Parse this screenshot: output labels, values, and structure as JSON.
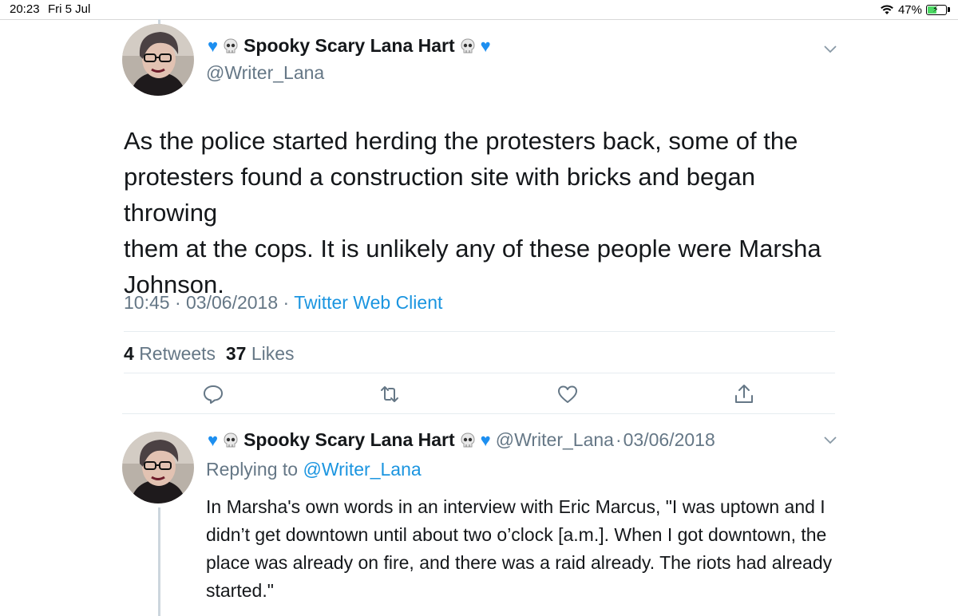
{
  "status_bar": {
    "time": "20:23",
    "date": "Fri 5 Jul",
    "battery": "47%",
    "battery_level": 0.47
  },
  "tweet": {
    "author": {
      "display_name": "Spooky Scary Lana Hart",
      "handle": "@Writer_Lana",
      "decorations": [
        "blue-heart-icon",
        "skull-icon"
      ]
    },
    "text_lines": [
      "As the police started herding the protesters back, some of the",
      "protesters found a construction site with bricks and began throwing",
      "them at the cops. It is unlikely any of these people were Marsha",
      "Johnson."
    ],
    "time": "10:45",
    "date": "03/06/2018",
    "sep": "·",
    "client": "Twitter Web Client",
    "retweets_count": "4",
    "retweets_label": "Retweets",
    "likes_count": "37",
    "likes_label": "Likes",
    "actions": [
      "reply-icon",
      "retweet-icon",
      "like-icon",
      "share-icon"
    ]
  },
  "reply": {
    "author": {
      "display_name": "Spooky Scary Lana Hart",
      "handle": "@Writer_Lana"
    },
    "date": "03/06/2018",
    "sep": "·",
    "replying_label": "Replying to",
    "replying_handle": "@Writer_Lana",
    "text_lines": [
      "In Marsha's own words in an interview with Eric Marcus, \"I was uptown and I",
      "didn’t get downtown until about two o’clock [a.m.]. When I got downtown, the",
      "place was already on fire, and there was a raid already. The riots had already",
      "started.\""
    ]
  },
  "colors": {
    "accent": "#1b95e0",
    "heart": "#1d8ff0",
    "secondary_text": "#657786",
    "divider": "#e6ecf0",
    "thread_line": "#ccd6dd"
  }
}
